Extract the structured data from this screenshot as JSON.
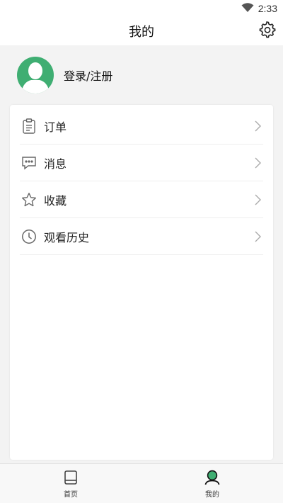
{
  "status_bar": {
    "time": "2:33"
  },
  "header": {
    "title": "我的"
  },
  "profile": {
    "login_label": "登录/注册"
  },
  "menu": {
    "items": [
      {
        "label": "订单",
        "icon": "clipboard-icon"
      },
      {
        "label": "消息",
        "icon": "message-icon"
      },
      {
        "label": "收藏",
        "icon": "star-icon"
      },
      {
        "label": "观看历史",
        "icon": "clock-icon"
      }
    ]
  },
  "bottom_nav": {
    "items": [
      {
        "label": "首页",
        "icon": "book-icon",
        "active": false
      },
      {
        "label": "我的",
        "icon": "profile-icon",
        "active": true
      }
    ]
  },
  "colors": {
    "accent": "#3fae72",
    "icon_gray": "#666666"
  }
}
